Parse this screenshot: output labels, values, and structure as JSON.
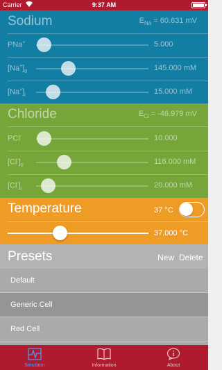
{
  "status_bar": {
    "carrier": "Carrier",
    "time": "9:37 AM"
  },
  "sodium": {
    "title": "Sodium",
    "potential_prefix": "E",
    "potential_sub": "Na",
    "potential_value": " = 60.631 mV",
    "rows": [
      {
        "label_main": "PNa",
        "label_sup": "+",
        "label_tail": "",
        "value": "5.000",
        "fraction": 0.07
      },
      {
        "label_main": "[Na",
        "label_sup": "+",
        "label_tail": "]",
        "label_sub": "0",
        "value": "145.000 mM",
        "fraction": 0.29
      },
      {
        "label_main": "[Na",
        "label_sup": "+",
        "label_tail": "]",
        "label_sub": "i",
        "value": "15.000 mM",
        "fraction": 0.15
      }
    ]
  },
  "chloride": {
    "title": "Chloride",
    "potential_prefix": "E",
    "potential_sub": "Cl",
    "potential_value": " = -46.979 mV",
    "rows": [
      {
        "label_main": "PCl",
        "label_sup": "-",
        "label_tail": "",
        "value": "10.000",
        "fraction": 0.07
      },
      {
        "label_main": "[Cl",
        "label_sup": "-",
        "label_tail": "]",
        "label_sub": "0",
        "value": "116.000 mM",
        "fraction": 0.25
      },
      {
        "label_main": "[Cl",
        "label_sup": "-",
        "label_tail": "]",
        "label_sub": "i",
        "value": "20.000 mM",
        "fraction": 0.11
      }
    ]
  },
  "temperature": {
    "title": "Temperature",
    "unit_label": "37 °C",
    "toggle_on": false,
    "value": "37.000 °C",
    "fraction": 0.37
  },
  "presets": {
    "title": "Presets",
    "new_label": "New",
    "delete_label": "Delete",
    "items": [
      {
        "label": "Default",
        "selected": false
      },
      {
        "label": "Generic Cell",
        "selected": true
      },
      {
        "label": "Red Cell",
        "selected": false
      }
    ]
  },
  "tabs": [
    {
      "label": "Simulator",
      "icon": "simulator-icon",
      "active": true
    },
    {
      "label": "Information",
      "icon": "book-icon",
      "active": false
    },
    {
      "label": "About",
      "icon": "info-icon",
      "active": false
    }
  ],
  "colors": {
    "sodium": "#137ea4",
    "chloride": "#76a63a",
    "temperature": "#ee9c25",
    "presets_header": "#b3b3b3",
    "tab_bar": "#b01a2e",
    "active_tab": "#4aa0ff"
  }
}
